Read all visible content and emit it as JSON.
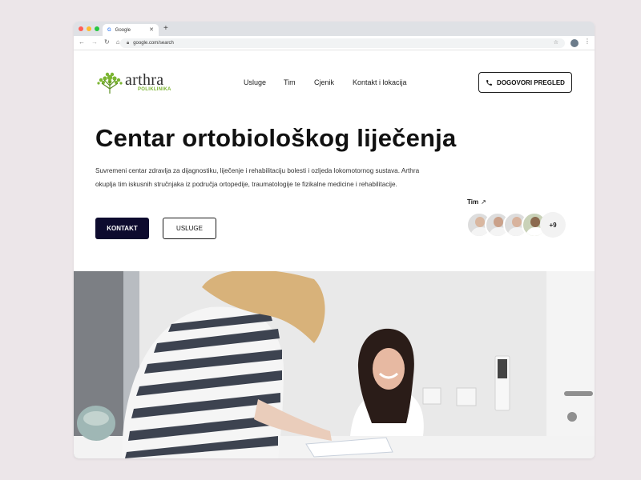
{
  "browser": {
    "tab_title": "Google",
    "tab_icon": "G",
    "url": "google.com/search"
  },
  "site": {
    "logo_word": "arthra",
    "logo_sub": "POLIKLINIKA",
    "nav": [
      "Usluge",
      "Tim",
      "Cjenik",
      "Kontakt i lokacija"
    ],
    "header_cta": "DOGOVORI PREGLED"
  },
  "hero": {
    "title": "Centar ortobiološkog liječenja",
    "description": "Suvremeni centar zdravlja za dijagnostiku, liječenje i rehabilitaciju bolesti i ozljeda lokomotornog sustava. Arthra okuplja tim iskusnih stručnjaka iz područja ortopedije, traumatologije te fizikalne medicine i rehabilitacije.",
    "primary_button": "KONTAKT",
    "secondary_button": "USLUGE"
  },
  "team": {
    "label": "Tim",
    "more_count": "+9"
  },
  "colors": {
    "page_bg": "#ece6e9",
    "primary_dark": "#0d0b2e",
    "logo_green": "#7bb532"
  }
}
